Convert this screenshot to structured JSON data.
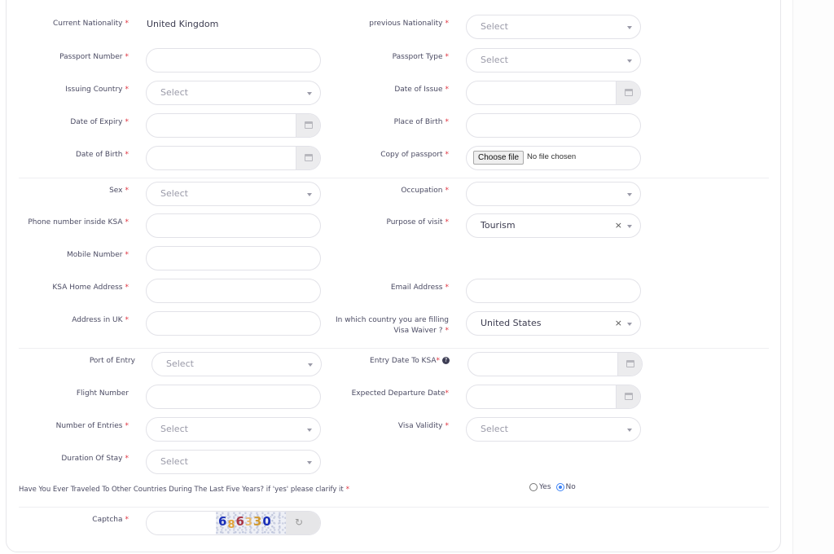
{
  "form": {
    "current_nationality": {
      "label": "Current Nationality",
      "required": "*",
      "value": "United Kingdom"
    },
    "previous_nationality": {
      "label": "previous Nationality",
      "required": "*",
      "placeholder": "Select"
    },
    "passport_number": {
      "label": "Passport Number",
      "required": "*",
      "value": ""
    },
    "passport_type": {
      "label": "Passport Type",
      "required": "*",
      "placeholder": "Select"
    },
    "issuing_country": {
      "label": "Issuing Country",
      "required": "*",
      "placeholder": "Select"
    },
    "date_of_issue": {
      "label": "Date of Issue",
      "required": "*",
      "value": ""
    },
    "date_of_expiry": {
      "label": "Date of Expiry",
      "required": "*",
      "value": ""
    },
    "place_of_birth": {
      "label": "Place of Birth",
      "required": "*",
      "value": ""
    },
    "date_of_birth": {
      "label": "Date of Birth",
      "required": "*",
      "value": ""
    },
    "copy_of_passport": {
      "label": "Copy of passport",
      "required": "*",
      "button": "Choose file",
      "status": "No file chosen"
    },
    "sex": {
      "label": "Sex",
      "required": "*",
      "placeholder": "Select"
    },
    "occupation": {
      "label": "Occupation",
      "required": "*",
      "value": ""
    },
    "phone_ksa": {
      "label": "Phone number inside KSA",
      "required": "*",
      "value": ""
    },
    "purpose_of_visit": {
      "label": "Purpose of visit",
      "required": "*",
      "value": "Tourism",
      "clear": "×"
    },
    "mobile_number": {
      "label": "Mobile Number",
      "required": "*",
      "value": ""
    },
    "ksa_home_address": {
      "label": "KSA Home Address",
      "required": "*",
      "value": ""
    },
    "email_address": {
      "label": "Email Address",
      "required": "*",
      "value": ""
    },
    "address_uk": {
      "label": "Address in UK",
      "required": "*",
      "value": ""
    },
    "filing_country": {
      "label": "In which country you are filling Visa Waiver ?",
      "required": "*",
      "value": "United States",
      "clear": "×"
    },
    "port_of_entry": {
      "label": "Port of Entry",
      "placeholder": "Select"
    },
    "entry_date": {
      "label": "Entry Date To KSA",
      "required": "*",
      "help": "?",
      "value": ""
    },
    "flight_number": {
      "label": "Flight Number",
      "value": ""
    },
    "expected_departure": {
      "label": "Expected Departure Date",
      "required": "*",
      "value": ""
    },
    "number_of_entries": {
      "label": "Number of Entries",
      "required": "*",
      "placeholder": "Select"
    },
    "visa_validity": {
      "label": "Visa Validity",
      "required": "*",
      "placeholder": "Select"
    },
    "duration_of_stay": {
      "label": "Duration Of Stay",
      "required": "*",
      "placeholder": "Select"
    },
    "travel_question": {
      "label": "Have You Ever Traveled To Other Countries During The Last Five Years? if 'yes' please clarify it",
      "required": "*",
      "options": [
        {
          "label": "Yes",
          "checked": false
        },
        {
          "label": "No",
          "checked": true
        }
      ]
    },
    "captcha": {
      "label": "Captcha",
      "required": "*",
      "value": "",
      "digits": [
        "6",
        "8",
        "6",
        "3",
        "3",
        "0"
      ]
    }
  }
}
